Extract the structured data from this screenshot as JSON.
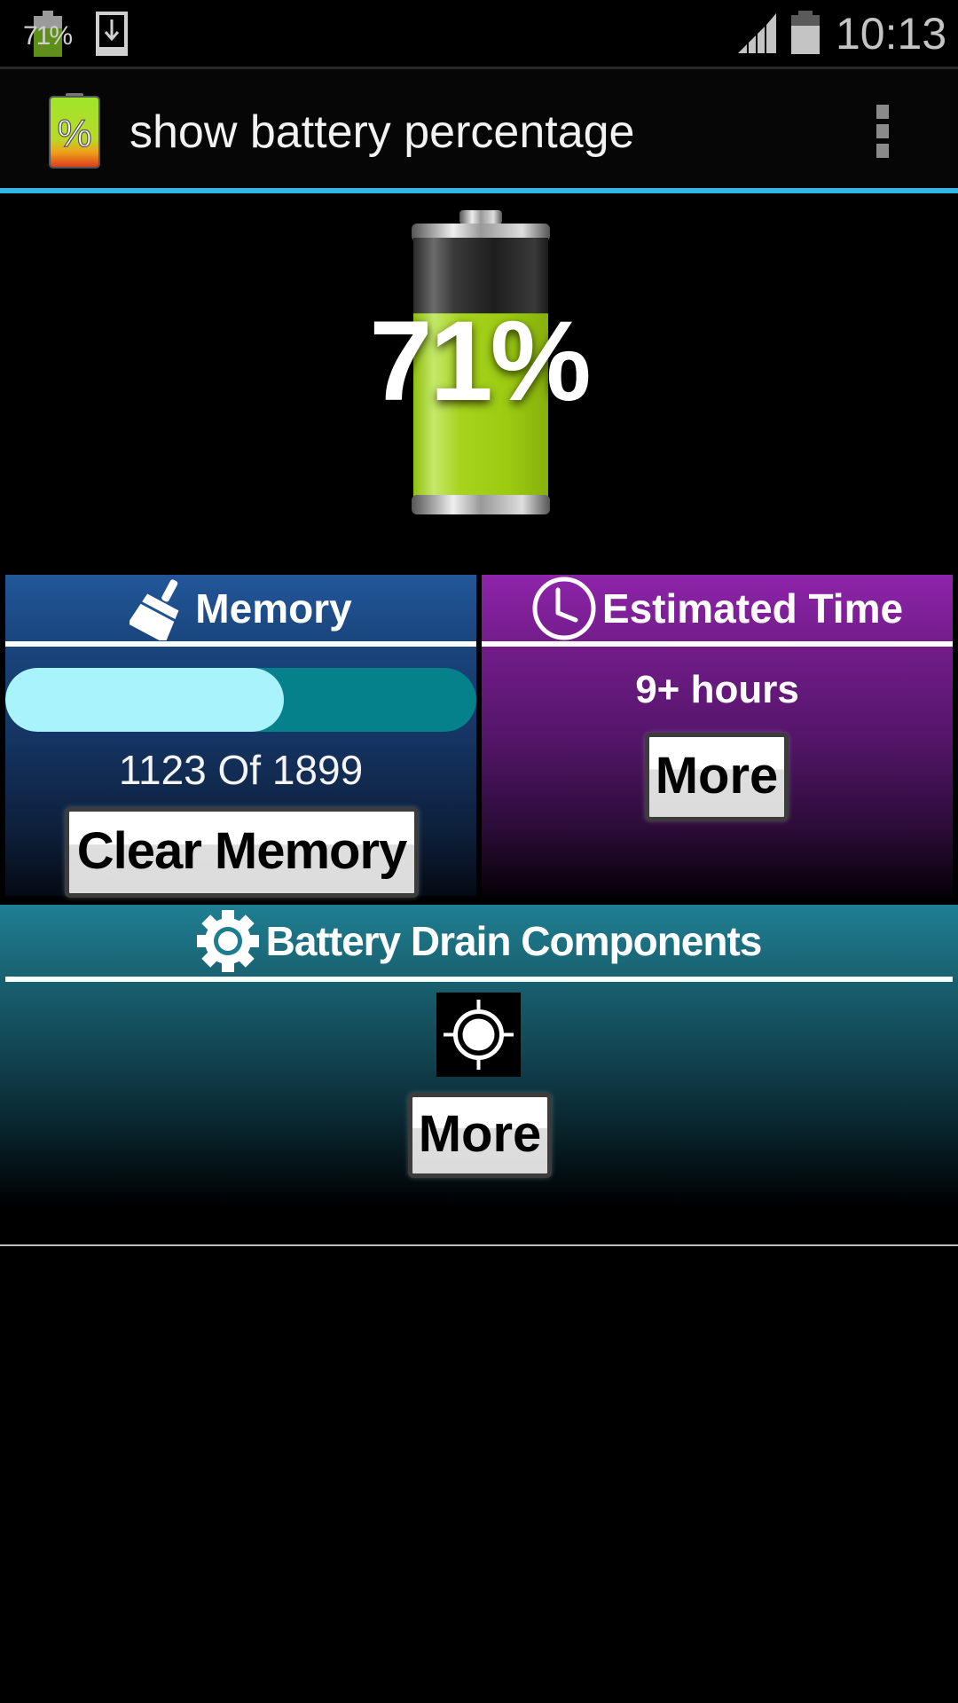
{
  "status_bar": {
    "battery_badge_text": "71%",
    "time": "10:13",
    "icons": [
      "battery-percent-notification-icon",
      "download-icon",
      "signal-icon",
      "battery-icon"
    ]
  },
  "action_bar": {
    "title": "show battery percentage",
    "app_icon": "battery-percent-app-icon",
    "overflow_icon": "overflow-menu-icon"
  },
  "battery": {
    "percent": 71,
    "percent_label": "71%",
    "fill_color": "#a6d31c"
  },
  "memory": {
    "title": "Memory",
    "icon": "broom-icon",
    "used": 1123,
    "total": 1899,
    "usage_fraction": 0.591,
    "usage_text": "1123 Of 1899",
    "button_label": "Clear Memory",
    "colors": {
      "header": "#22579a",
      "bar_track": "#04818a",
      "bar_fill": "#a8f3fc"
    }
  },
  "estimated_time": {
    "title": "Estimated Time",
    "icon": "clock-icon",
    "value": "9+ hours",
    "button_label": "More",
    "colors": {
      "header": "#8e24aa"
    }
  },
  "drain": {
    "title": "Battery Drain Components",
    "icon": "gear-icon",
    "components": [
      {
        "icon": "gps-icon"
      }
    ],
    "button_label": "More",
    "colors": {
      "header": "#1f7f92"
    }
  },
  "theme": {
    "accent": "#33b5e5",
    "background": "#000000"
  }
}
